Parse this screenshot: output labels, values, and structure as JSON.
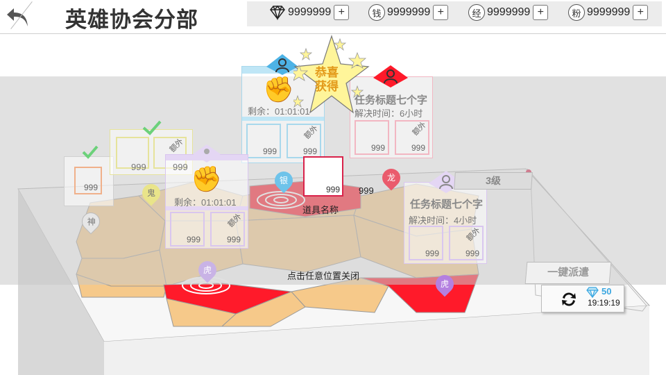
{
  "header": {
    "title": "英雄协会分部"
  },
  "resources": [
    {
      "icon": "diamond-icon",
      "label": "",
      "value": "9999999"
    },
    {
      "icon": "coin-icon",
      "label": "钱",
      "value": "9999999"
    },
    {
      "icon": "exp-icon",
      "label": "经",
      "value": "9999999"
    },
    {
      "icon": "powder-icon",
      "label": "粉",
      "value": "9999999"
    }
  ],
  "plus_label": "+",
  "reward_popup": {
    "star_text_line1": "恭喜",
    "star_text_line2": "获得",
    "item_count": "999",
    "item_name": "道具名称",
    "side_count": "999",
    "close_hint": "点击任意位置关闭"
  },
  "cards": {
    "fist1": {
      "remaining": "剩余：01:01:01",
      "slot1": "999",
      "slot2": "999",
      "extra": "额外"
    },
    "fist2": {
      "remaining": "剩余：01:01:01",
      "slot0": "999",
      "slot1": "999",
      "slot2": "999",
      "extra": "额外"
    },
    "task_red": {
      "title": "任务标题七个字",
      "time": "解决时间：6小时",
      "slot1": "999",
      "slot2": "999",
      "extra": "额外"
    },
    "task_purple": {
      "title": "任务标题七个字",
      "time": "解决时间：4小时",
      "slot1": "999",
      "slot2": "999",
      "extra": "额外"
    },
    "check_green": {
      "slot1": "999",
      "extra": "额外"
    },
    "check_gray": {
      "slot1": "999"
    }
  },
  "pins": {
    "shen": "神",
    "gui": "鬼",
    "yin": "银",
    "hu1": "虎",
    "hu2": "虎",
    "red": "龙"
  },
  "panel": {
    "level": "3级",
    "dispatch_label": "一键派遣",
    "diamond_cost": "50",
    "timer": "19:19:19"
  },
  "colors": {
    "accent_red": "#d9224a",
    "star_yellow": "#fff59a",
    "star_text": "#e39a1a",
    "gem_blue": "#3aa6e0"
  }
}
